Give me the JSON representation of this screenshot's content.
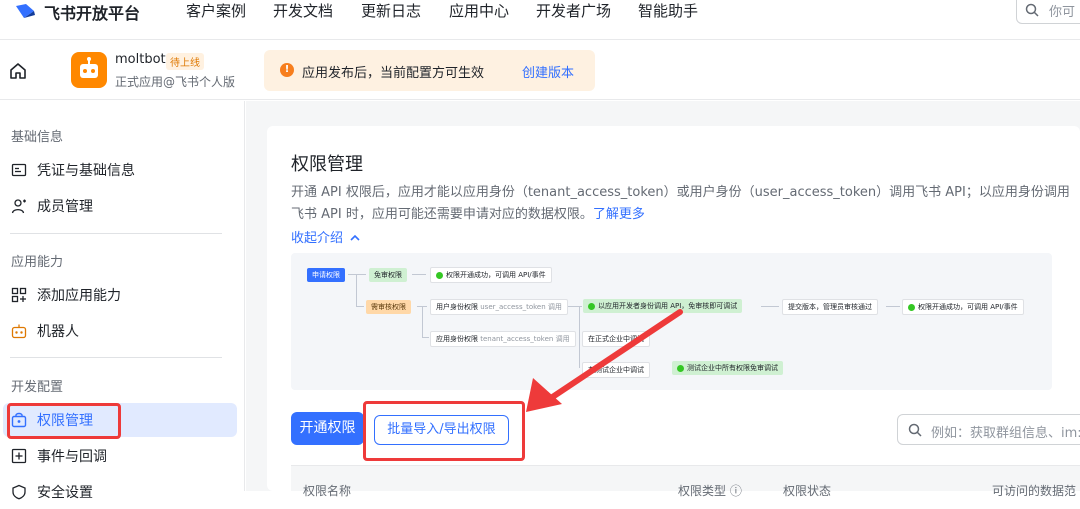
{
  "topbar": {
    "brand": "飞书开放平台",
    "nav": [
      "客户案例",
      "开发文档",
      "更新日志",
      "应用中心",
      "开发者广场",
      "智能助手"
    ],
    "search_placeholder": "你可"
  },
  "app": {
    "name": "moltbot",
    "badge": "待上线",
    "subtitle": "正式应用@飞书个人版"
  },
  "notice": {
    "text": "应用发布后，当前配置方可生效",
    "link": "创建版本"
  },
  "sidebar": {
    "sections": [
      {
        "title": "基础信息",
        "items": [
          {
            "label": "凭证与基础信息",
            "icon": "credential-icon"
          },
          {
            "label": "成员管理",
            "icon": "member-icon"
          }
        ]
      },
      {
        "title": "应用能力",
        "items": [
          {
            "label": "添加应用能力",
            "icon": "add-capability-icon"
          },
          {
            "label": "机器人",
            "icon": "robot-icon"
          }
        ]
      },
      {
        "title": "开发配置",
        "items": [
          {
            "label": "权限管理",
            "icon": "permission-icon",
            "active": true
          },
          {
            "label": "事件与回调",
            "icon": "event-icon"
          },
          {
            "label": "安全设置",
            "icon": "security-icon"
          }
        ]
      }
    ]
  },
  "main": {
    "title": "权限管理",
    "desc_part1": "开通 API 权限后，应用才能以应用身份（tenant_access_token）或用户身份（user_access_token）调用飞书 API；以应用身份调用飞书 API 时，应用可能还需要申请对应的数据权限。",
    "desc_link": "了解更多",
    "collapse": "收起介绍",
    "flow": {
      "apply": "申请权限",
      "no_review": "免审权限",
      "no_review_result": "权限开通成功，可调用 API/事件",
      "need_review": "需审核权限",
      "user_perm": "用户身份权限",
      "user_token": "user_access_token 调用",
      "dev_call": "以应用开发者身份调用 API，免审核即可调试",
      "submit": "提交版本，管理员审核通过",
      "final_result": "权限开通成功，可调用 API/事件",
      "app_perm": "应用身份权限",
      "tenant_token": "tenant_access_token 调用",
      "formal_debug": "在正式企业中调试",
      "test_debug": "在测试企业中调试",
      "test_result": "测试企业中所有权限免审调试"
    },
    "btn_open": "开通权限",
    "btn_batch": "批量导入/导出权限",
    "search_placeholder": "例如：获取群组信息、im:",
    "table_headers": [
      "权限名称",
      "权限类型 ⓘ",
      "权限状态",
      "可访问的数据范"
    ]
  },
  "colors": {
    "accent": "#3370ff",
    "annotation_red": "#ee3a3a"
  }
}
